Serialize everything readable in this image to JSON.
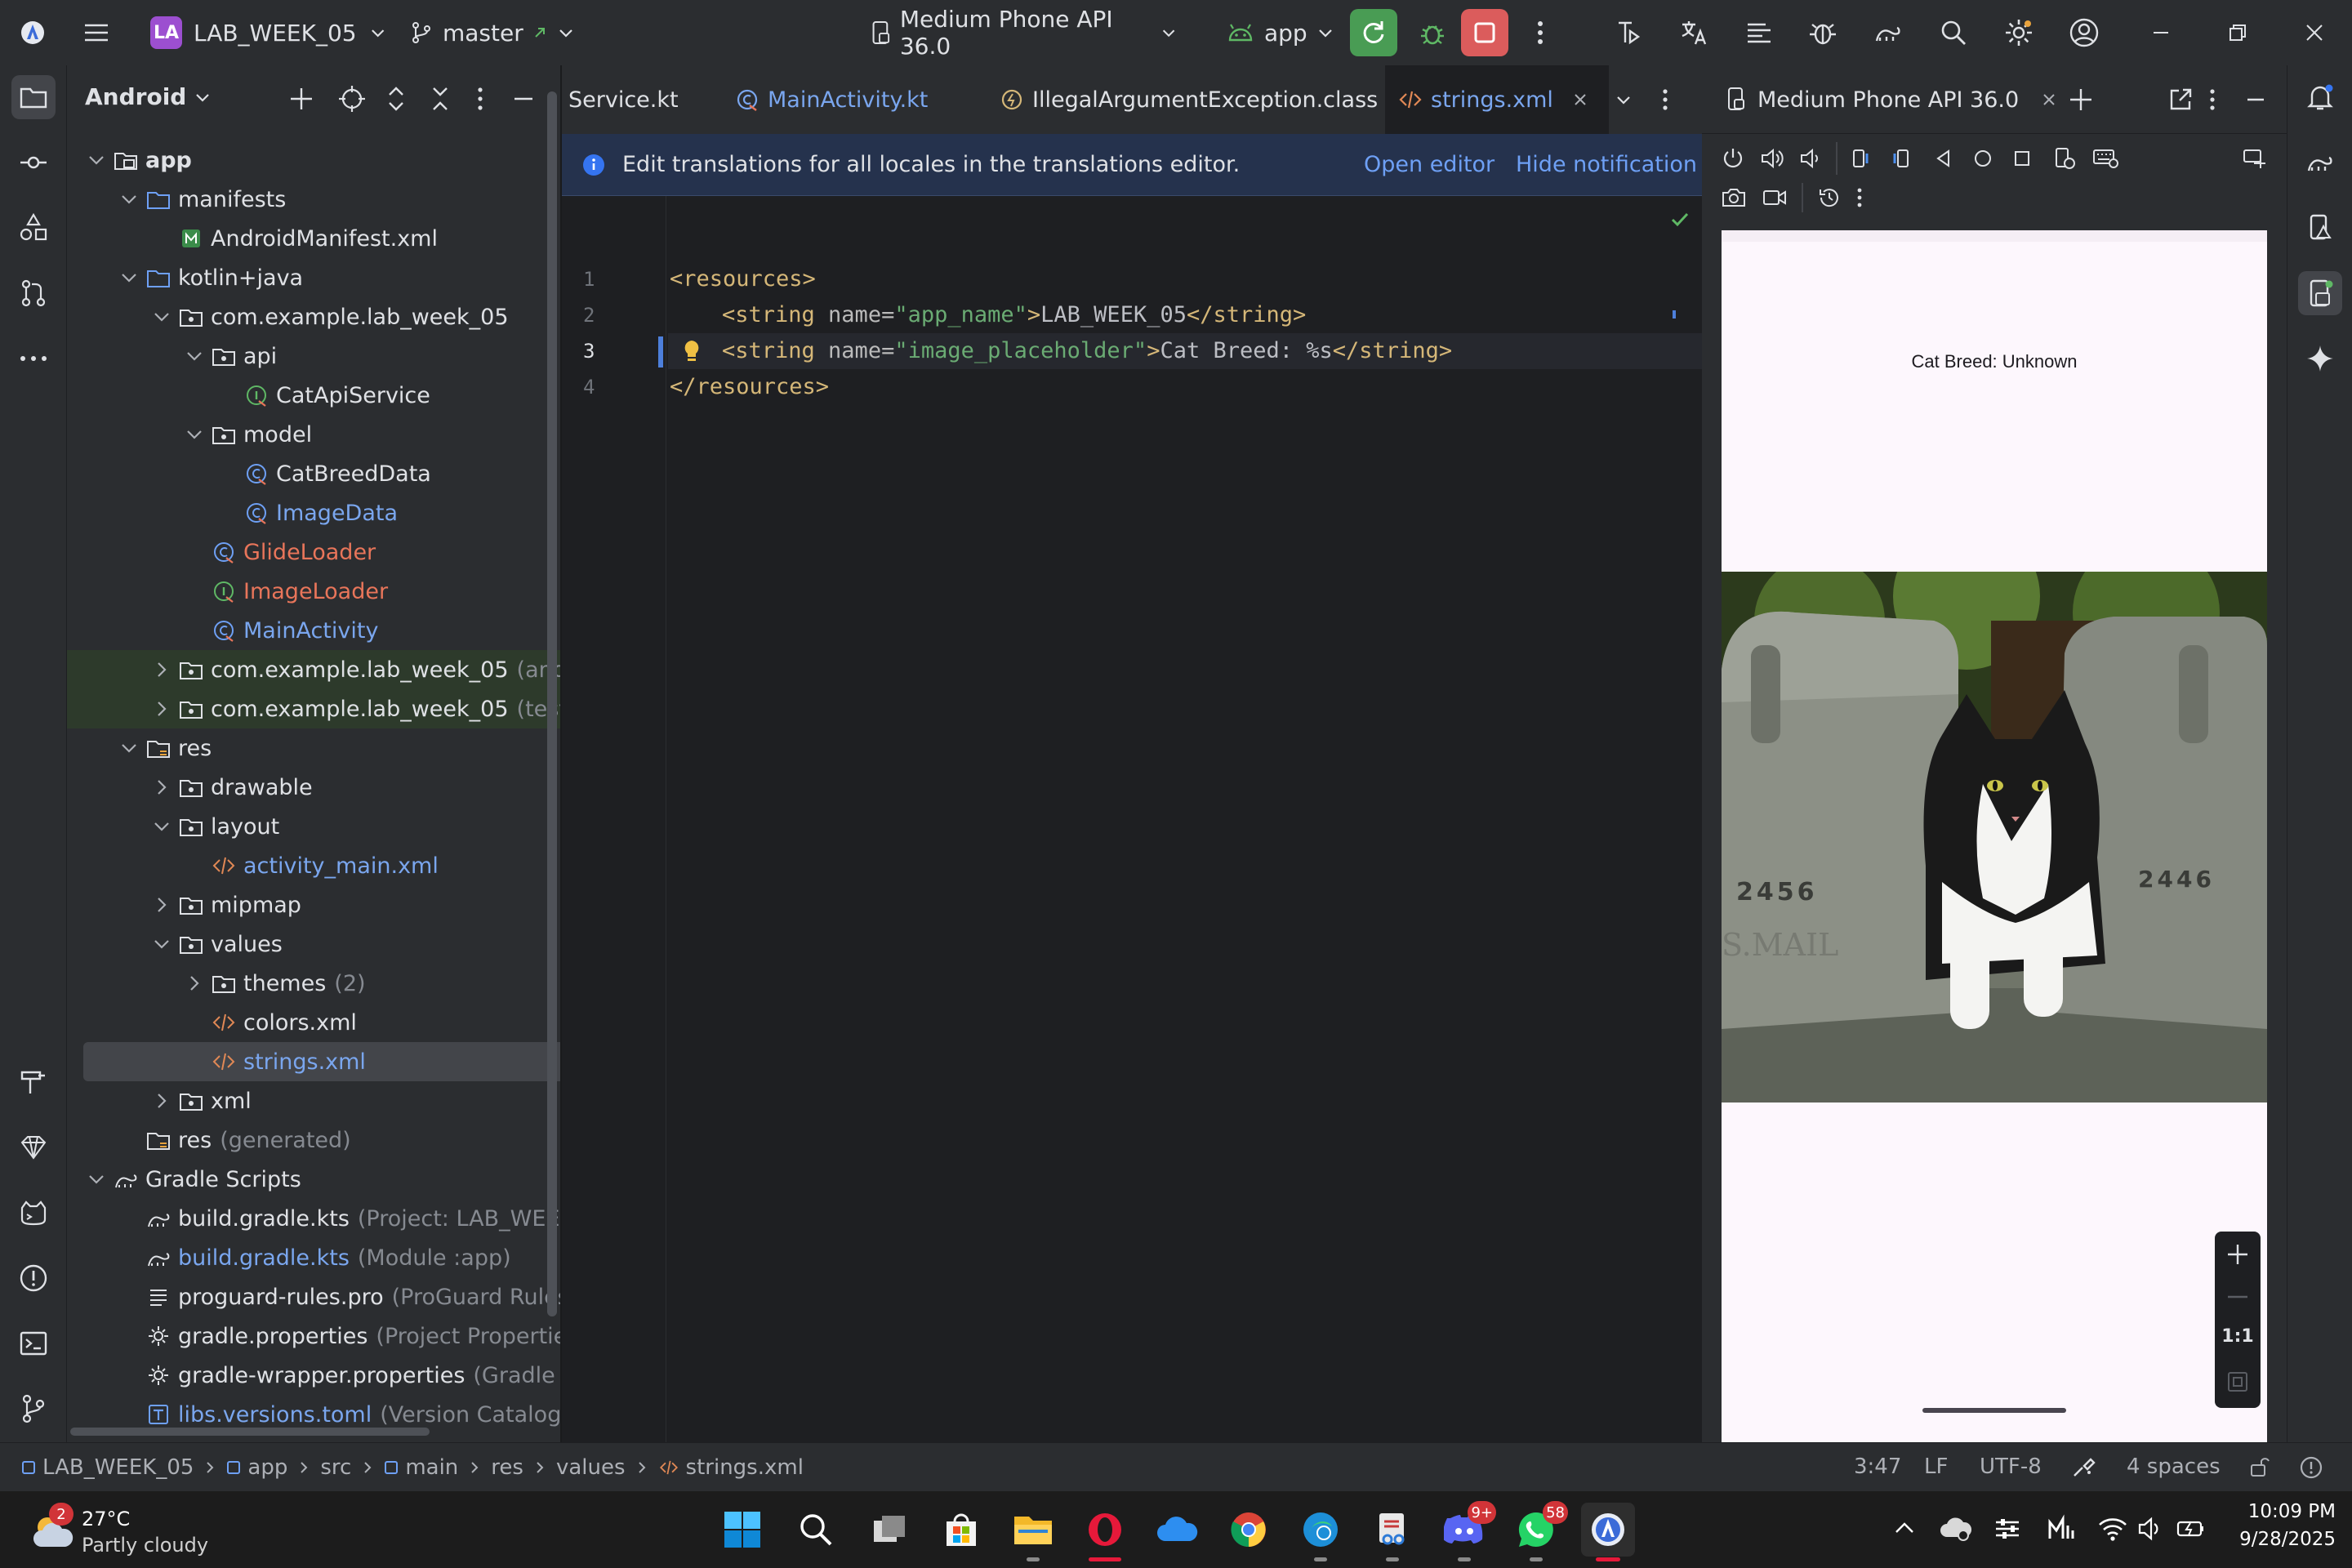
{
  "titlebar": {
    "project_badge": "LA",
    "project_name": "LAB_WEEK_05",
    "branch": "master",
    "device_selector": "Medium Phone API 36.0",
    "run_config": "app"
  },
  "project_panel": {
    "view_label": "Android",
    "tree": [
      {
        "label": "app",
        "hint": "",
        "icon": "module-folder-icon"
      },
      {
        "label": "manifests",
        "hint": "",
        "icon": "folder-icon"
      },
      {
        "label": "AndroidManifest.xml",
        "hint": "",
        "icon": "manifest-icon"
      },
      {
        "label": "kotlin+java",
        "hint": "",
        "icon": "folder-icon"
      },
      {
        "label": "com.example.lab_week_05",
        "hint": "",
        "icon": "package-icon"
      },
      {
        "label": "api",
        "hint": "",
        "icon": "package-icon"
      },
      {
        "label": "CatApiService",
        "hint": "",
        "icon": "kotlin-interface-icon"
      },
      {
        "label": "model",
        "hint": "",
        "icon": "package-icon"
      },
      {
        "label": "CatBreedData",
        "hint": "",
        "icon": "kotlin-class-icon"
      },
      {
        "label": "ImageData",
        "hint": "",
        "icon": "kotlin-class-icon"
      },
      {
        "label": "GlideLoader",
        "hint": "",
        "icon": "kotlin-class-icon"
      },
      {
        "label": "ImageLoader",
        "hint": "",
        "icon": "kotlin-interface-icon"
      },
      {
        "label": "MainActivity",
        "hint": "",
        "icon": "kotlin-class-icon"
      },
      {
        "label": "com.example.lab_week_05",
        "hint": "(androi",
        "icon": "package-icon"
      },
      {
        "label": "com.example.lab_week_05",
        "hint": "(test)",
        "icon": "package-icon"
      },
      {
        "label": "res",
        "hint": "",
        "icon": "res-folder-icon"
      },
      {
        "label": "drawable",
        "hint": "",
        "icon": "package-icon"
      },
      {
        "label": "layout",
        "hint": "",
        "icon": "package-icon"
      },
      {
        "label": "activity_main.xml",
        "hint": "",
        "icon": "xml-file-icon"
      },
      {
        "label": "mipmap",
        "hint": "",
        "icon": "package-icon"
      },
      {
        "label": "values",
        "hint": "",
        "icon": "package-icon"
      },
      {
        "label": "themes",
        "hint": "(2)",
        "icon": "package-icon"
      },
      {
        "label": "colors.xml",
        "hint": "",
        "icon": "xml-file-icon"
      },
      {
        "label": "strings.xml",
        "hint": "",
        "icon": "xml-file-icon"
      },
      {
        "label": "xml",
        "hint": "",
        "icon": "package-icon"
      },
      {
        "label": "res",
        "hint": "(generated)",
        "icon": "res-folder-icon"
      },
      {
        "label": "Gradle Scripts",
        "hint": "",
        "icon": "gradle-icon"
      },
      {
        "label": "build.gradle.kts",
        "hint": "(Project: LAB_WEEK_(",
        "icon": "gradle-file-icon"
      },
      {
        "label": "build.gradle.kts",
        "hint": "(Module :app)",
        "icon": "gradle-file-icon"
      },
      {
        "label": "proguard-rules.pro",
        "hint": "(ProGuard Rules fo",
        "icon": "text-file-icon"
      },
      {
        "label": "gradle.properties",
        "hint": "(Project Properties)",
        "icon": "settings-file-icon"
      },
      {
        "label": "gradle-wrapper.properties",
        "hint": "(Gradle Ve",
        "icon": "settings-file-icon"
      },
      {
        "label": "libs.versions.toml",
        "hint": "(Version Catalog \"lib",
        "icon": "toml-file-icon"
      }
    ]
  },
  "editor": {
    "tabs": [
      {
        "label": "Service.kt"
      },
      {
        "label": "MainActivity.kt"
      },
      {
        "label": "IllegalArgumentException.class"
      },
      {
        "label": "strings.xml"
      }
    ],
    "notification": {
      "text": "Edit translations for all locales in the translations editor.",
      "open_editor": "Open editor",
      "hide": "Hide notification"
    },
    "line_numbers": [
      "1",
      "2",
      "3",
      "4"
    ],
    "code": {
      "l1_open": "<resources>",
      "l2_tag_open": "<string ",
      "l2_attr": "name=",
      "l2_val": "\"app_name\"",
      "l2_close": ">",
      "l2_text": "LAB_WEEK_05",
      "l2_end": "</string>",
      "l3_tag_open": "<string ",
      "l3_attr": "name=",
      "l3_val": "\"image_placeholder\"",
      "l3_close": ">",
      "l3_text": "Cat Breed: %s",
      "l3_end": "</string>",
      "l4_close": "</resources>"
    }
  },
  "device_panel": {
    "tab_label": "Medium Phone API 36.0",
    "app_text": "Cat Breed: Unknown",
    "zoom_label": "1:1"
  },
  "statusbar": {
    "breadcrumbs": [
      "LAB_WEEK_05",
      "app",
      "src",
      "main",
      "res",
      "values",
      "strings.xml"
    ],
    "cursor": "3:47",
    "line_sep": "LF",
    "encoding": "UTF-8",
    "indent": "4 spaces"
  },
  "taskbar": {
    "weather_temp": "27°C",
    "weather_desc": "Partly cloudy",
    "weather_badge": "2",
    "discord_badge": "9+",
    "whatsapp_badge": "58",
    "time": "10:09 PM",
    "date": "9/28/2025"
  },
  "colors": {
    "accent": "#3574f0",
    "ide_bg": "#1e1f22",
    "panel_bg": "#2b2d30",
    "run_green": "#499c54",
    "stop_red": "#db5c5c"
  }
}
